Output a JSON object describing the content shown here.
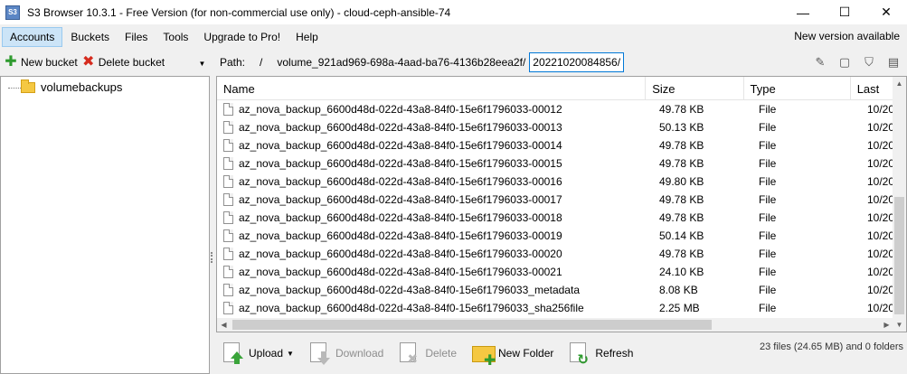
{
  "window": {
    "title": "S3 Browser 10.3.1 - Free Version (for non-commercial use only) - cloud-ceph-ansible-74",
    "app_icon": "S3",
    "controls": {
      "minimize": "—",
      "maximize": "☐",
      "close": "✕"
    }
  },
  "menu": {
    "items": [
      "Accounts",
      "Buckets",
      "Files",
      "Tools",
      "Upgrade to Pro!",
      "Help"
    ],
    "active": "Accounts",
    "new_version": "New version available"
  },
  "left": {
    "new_bucket": "New bucket",
    "delete_bucket": "Delete bucket",
    "tree": [
      {
        "label": "volumebackups"
      }
    ]
  },
  "path": {
    "label": "Path:",
    "root": "/",
    "segment": "volume_921ad969-698a-4aad-ba76-4136b28eea2f/",
    "current": "20221020084856/"
  },
  "table": {
    "columns": {
      "name": "Name",
      "size": "Size",
      "type": "Type",
      "last": "Last"
    },
    "rows": [
      {
        "name": "az_nova_backup_6600d48d-022d-43a8-84f0-15e6f1796033-00012",
        "size": "49.78 KB",
        "type": "File",
        "last": "10/20"
      },
      {
        "name": "az_nova_backup_6600d48d-022d-43a8-84f0-15e6f1796033-00013",
        "size": "50.13 KB",
        "type": "File",
        "last": "10/20"
      },
      {
        "name": "az_nova_backup_6600d48d-022d-43a8-84f0-15e6f1796033-00014",
        "size": "49.78 KB",
        "type": "File",
        "last": "10/20"
      },
      {
        "name": "az_nova_backup_6600d48d-022d-43a8-84f0-15e6f1796033-00015",
        "size": "49.78 KB",
        "type": "File",
        "last": "10/20"
      },
      {
        "name": "az_nova_backup_6600d48d-022d-43a8-84f0-15e6f1796033-00016",
        "size": "49.80 KB",
        "type": "File",
        "last": "10/20"
      },
      {
        "name": "az_nova_backup_6600d48d-022d-43a8-84f0-15e6f1796033-00017",
        "size": "49.78 KB",
        "type": "File",
        "last": "10/20"
      },
      {
        "name": "az_nova_backup_6600d48d-022d-43a8-84f0-15e6f1796033-00018",
        "size": "49.78 KB",
        "type": "File",
        "last": "10/20"
      },
      {
        "name": "az_nova_backup_6600d48d-022d-43a8-84f0-15e6f1796033-00019",
        "size": "50.14 KB",
        "type": "File",
        "last": "10/20"
      },
      {
        "name": "az_nova_backup_6600d48d-022d-43a8-84f0-15e6f1796033-00020",
        "size": "49.78 KB",
        "type": "File",
        "last": "10/20"
      },
      {
        "name": "az_nova_backup_6600d48d-022d-43a8-84f0-15e6f1796033-00021",
        "size": "24.10 KB",
        "type": "File",
        "last": "10/20"
      },
      {
        "name": "az_nova_backup_6600d48d-022d-43a8-84f0-15e6f1796033_metadata",
        "size": "8.08 KB",
        "type": "File",
        "last": "10/20"
      },
      {
        "name": "az_nova_backup_6600d48d-022d-43a8-84f0-15e6f1796033_sha256file",
        "size": "2.25 MB",
        "type": "File",
        "last": "10/20"
      }
    ]
  },
  "actions": {
    "upload": "Upload",
    "download": "Download",
    "delete": "Delete",
    "new_folder": "New Folder",
    "refresh": "Refresh"
  },
  "status": "23 files (24.65 MB) and 0 folders"
}
